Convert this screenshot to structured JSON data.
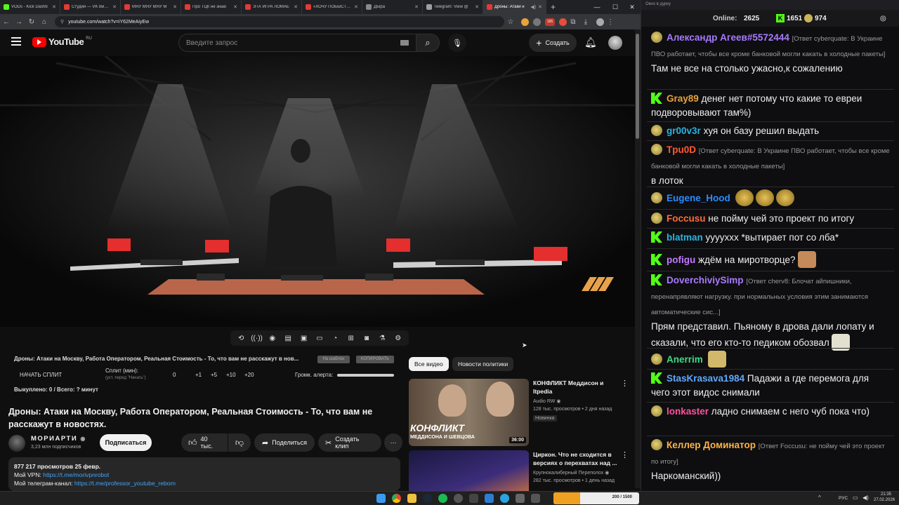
{
  "browser": {
    "tabs": [
      {
        "label": "VODs - Kick Dashb",
        "color": "#53fc18"
      },
      {
        "label": "Студия — VK Видео",
        "color": "#e53935"
      },
      {
        "label": "МЯУ МЯУ МЯУ М",
        "color": "#e53935"
      },
      {
        "label": "Про ТЦК не знаю",
        "color": "#e53935"
      },
      {
        "label": "ЭТА ИГРА ЛОМАЕ",
        "color": "#e53935"
      },
      {
        "label": "«ХОЧУ ПОБЫСТРЕ",
        "color": "#e53935"
      },
      {
        "label": "ДЫра",
        "color": "#888888"
      },
      {
        "label": "Telegram: View @",
        "color": "#9aa0a6"
      },
      {
        "label": "Дроны: Атаки н",
        "color": "#e53935"
      }
    ],
    "url": "youtube.com/watch?v=iY62MeAiyEw",
    "ext_count": "165"
  },
  "yt": {
    "logo": "YouTube",
    "region": "RU",
    "search_placeholder": "Введите запрос",
    "create_label": "Создать",
    "ext_panel": {
      "title_short": "Дроны: Атаки на Москву, Работа Оператором, Реальная Стоимость - То, что вам не расскажут в нов...",
      "btn_copy_title": "На шаблон",
      "btn_copy": "КОПИРОВАТЬ",
      "split_start": "НАЧАТЬ СПЛИТ",
      "split_label": "Сплит (мин):",
      "split_hint": "(уст. перед \"Начать\")",
      "split_values": [
        "0",
        "+1",
        "+5",
        "+10",
        "+20"
      ],
      "volume_label": "Громк. алерта:",
      "paid_line": "Выкуплено: 0 / Всего: ? минут"
    },
    "video_title": "Дроны: Атаки на Москву, Работа Оператором, Реальная Стоимость - То, что вам не расскажут в новостях.",
    "channel": {
      "name": "МОРИАРТИ",
      "subs": "3,23 млн подписчиков",
      "subscribe": "Подписаться"
    },
    "actions": {
      "likes": "40 тыс.",
      "share": "Поделиться",
      "clip": "Создать клип"
    },
    "description": {
      "line1": "877 217 просмотров  25 февр.",
      "vpn_label": "Мой VPN: ",
      "vpn_link": "https://t.me/morivpnrobot",
      "tg_label": "Мой телеграм-канал: ",
      "tg_link": "https://t.me/professor_youtube_reborn"
    },
    "chips": [
      "Все видео",
      "Новости политики"
    ],
    "recs": [
      {
        "title": "КОНФЛИКТ Меддисон и Itpedia",
        "channel": "Audio RW",
        "meta": "128 тыс. просмотров • 2 дня назад",
        "badge": "Новинка",
        "duration": "36:00",
        "thumb_text": "КОНФЛИКТ",
        "thumb_sub": "МЕДДИСОНА И ШЕВЦОВА"
      },
      {
        "title": "Циркон. Что не сходится в версиях о перехватах над ...",
        "channel": "Крупнокалиберный Переполох",
        "meta": "282 тыс. просмотров • 1 день назад"
      }
    ]
  },
  "chat": {
    "window_title": "Окно в дурку",
    "online_label": "Online:",
    "online": "2625",
    "kick_count": "1651",
    "other_count": "974",
    "messages": [
      {
        "platform": "other",
        "user": "Александр Агеев#5572444",
        "color": "#a77bff",
        "reply": "[Ответ cyberquate: В Украине ПВО работает, чтобы все кроме банковой могли какать в холодные пакеты]",
        "text": "Там не все на столько ужасно,к сожалению"
      },
      {
        "platform": "kick",
        "user": "Gray89",
        "color": "#e8a33a",
        "text": "денег нет потому что какие то евреи подворовывают там%)"
      },
      {
        "platform": "other",
        "user": "gr00v3r",
        "color": "#2bb3e0",
        "text": "хуя он базу решил выдать"
      },
      {
        "platform": "other",
        "user": "Tpu0D",
        "color": "#ff5a36",
        "reply": "[Ответ cyberquate: В Украине ПВО работает, чтобы все кроме банковой могли какать в холодные пакеты]",
        "text": "в лоток"
      },
      {
        "platform": "other",
        "user": "Eugene_Hood",
        "color": "#2b8cff",
        "text": ""
      },
      {
        "platform": "other",
        "user": "Foccusu",
        "color": "#ff6b3d",
        "text": "не пойму чей это проект по итогу"
      },
      {
        "platform": "kick",
        "user": "blatman",
        "color": "#2bb3e0",
        "text": "ууууххх *вытирает пот со лба*"
      },
      {
        "platform": "kick",
        "user": "pofigu",
        "color": "#c678ff",
        "text": "ждём на миротворце?"
      },
      {
        "platform": "kick",
        "user": "DoverchiviySimp",
        "color": "#a77bff",
        "reply": "[Ответ cherv8: Блочат айпишники, перенапрявляют нагрузку. при нормальных условия этим занимаются автоматические сис...]",
        "text": "Прям представил. Пьяному в дрова дали лопату и сказали, что его кто-то педиком обозвал"
      },
      {
        "platform": "other",
        "user": "Anerrim",
        "color": "#3ddc84",
        "text": ""
      },
      {
        "platform": "kick",
        "user": "StasKrasava1984",
        "color": "#5fa8ff",
        "text": "Падажи а где перемога для чего этот видос снимали"
      },
      {
        "platform": "other",
        "user": "lonkaster",
        "color": "#ff4fa0",
        "text": "ладно снимаем с него чуб пока что)"
      },
      {
        "platform": "other",
        "user": "Келлер Доминатор",
        "color": "#ffb347",
        "reply": "[Ответ Foccusu: не пойму чей это проект по итогу]",
        "text": "Наркоманский))"
      }
    ]
  },
  "taskbar": {
    "lang": "РУС",
    "time": "21:35",
    "date": "27.02.2026",
    "progress": "200 / 1500"
  }
}
